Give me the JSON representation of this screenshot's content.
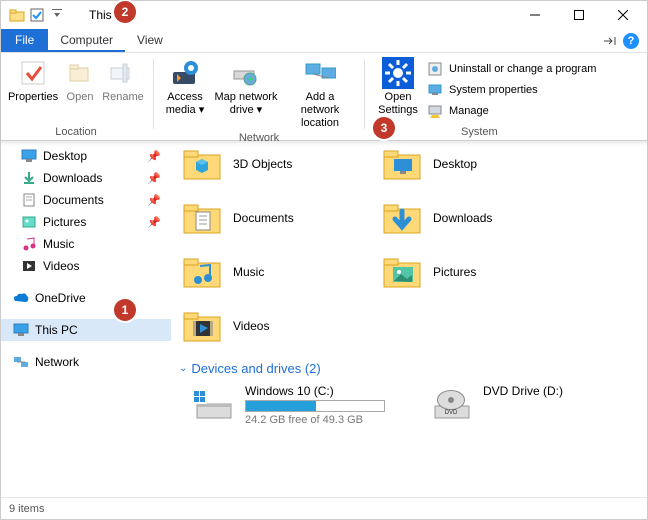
{
  "title": "This PC",
  "tabs": {
    "file": "File",
    "computer": "Computer",
    "view": "View"
  },
  "ribbon": {
    "location": {
      "properties": "Properties",
      "open": "Open",
      "rename": "Rename",
      "label": "Location"
    },
    "network": {
      "access_media": "Access media",
      "map_drive": "Map network drive",
      "add_location": "Add a network location",
      "label": "Network"
    },
    "system": {
      "open_settings": "Open Settings",
      "uninstall": "Uninstall or change a program",
      "properties": "System properties",
      "manage": "Manage",
      "label": "System"
    }
  },
  "nav": {
    "desktop": "Desktop",
    "downloads": "Downloads",
    "documents": "Documents",
    "pictures": "Pictures",
    "music": "Music",
    "videos": "Videos",
    "onedrive": "OneDrive",
    "thispc": "This PC",
    "network": "Network"
  },
  "folders": {
    "3d": "3D Objects",
    "desktop": "Desktop",
    "documents": "Documents",
    "downloads": "Downloads",
    "music": "Music",
    "pictures": "Pictures",
    "videos": "Videos"
  },
  "devices_header": "Devices and drives (2)",
  "drives": {
    "c": {
      "name": "Windows 10 (C:)",
      "free": "24.2 GB free of 49.3 GB"
    },
    "d": {
      "name": "DVD Drive (D:)"
    }
  },
  "status": "9 items",
  "markers": {
    "m1": "1",
    "m2": "2",
    "m3": "3"
  }
}
